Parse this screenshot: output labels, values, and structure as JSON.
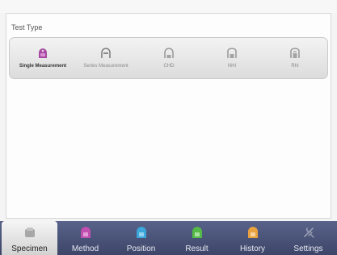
{
  "panel": {
    "title": "Test Type"
  },
  "test_types": [
    {
      "label": "Single Measurement",
      "icon": "single-measurement-icon",
      "active": true
    },
    {
      "label": "Series Measurement",
      "icon": "series-measurement-icon",
      "active": false
    },
    {
      "label": "CHD",
      "icon": "chd-icon",
      "active": false
    },
    {
      "label": "NHI",
      "icon": "nhi-icon",
      "active": false
    },
    {
      "label": "RhI",
      "icon": "rhi-icon",
      "active": false
    }
  ],
  "tabs": [
    {
      "label": "Specimen",
      "icon": "specimen-icon",
      "color": "#9a9a9a",
      "active": true
    },
    {
      "label": "Method",
      "icon": "method-icon",
      "color": "#c04fb0",
      "active": false
    },
    {
      "label": "Position",
      "icon": "position-icon",
      "color": "#3aa6d9",
      "active": false
    },
    {
      "label": "Result",
      "icon": "result-icon",
      "color": "#55b947",
      "active": false
    },
    {
      "label": "History",
      "icon": "history-icon",
      "color": "#e9a23d",
      "active": false
    },
    {
      "label": "Settings",
      "icon": "settings-icon",
      "color": "#9aa0b4",
      "active": false
    }
  ],
  "colors": {
    "accent": "#a54aa0",
    "tabbar": "#4a5478"
  }
}
